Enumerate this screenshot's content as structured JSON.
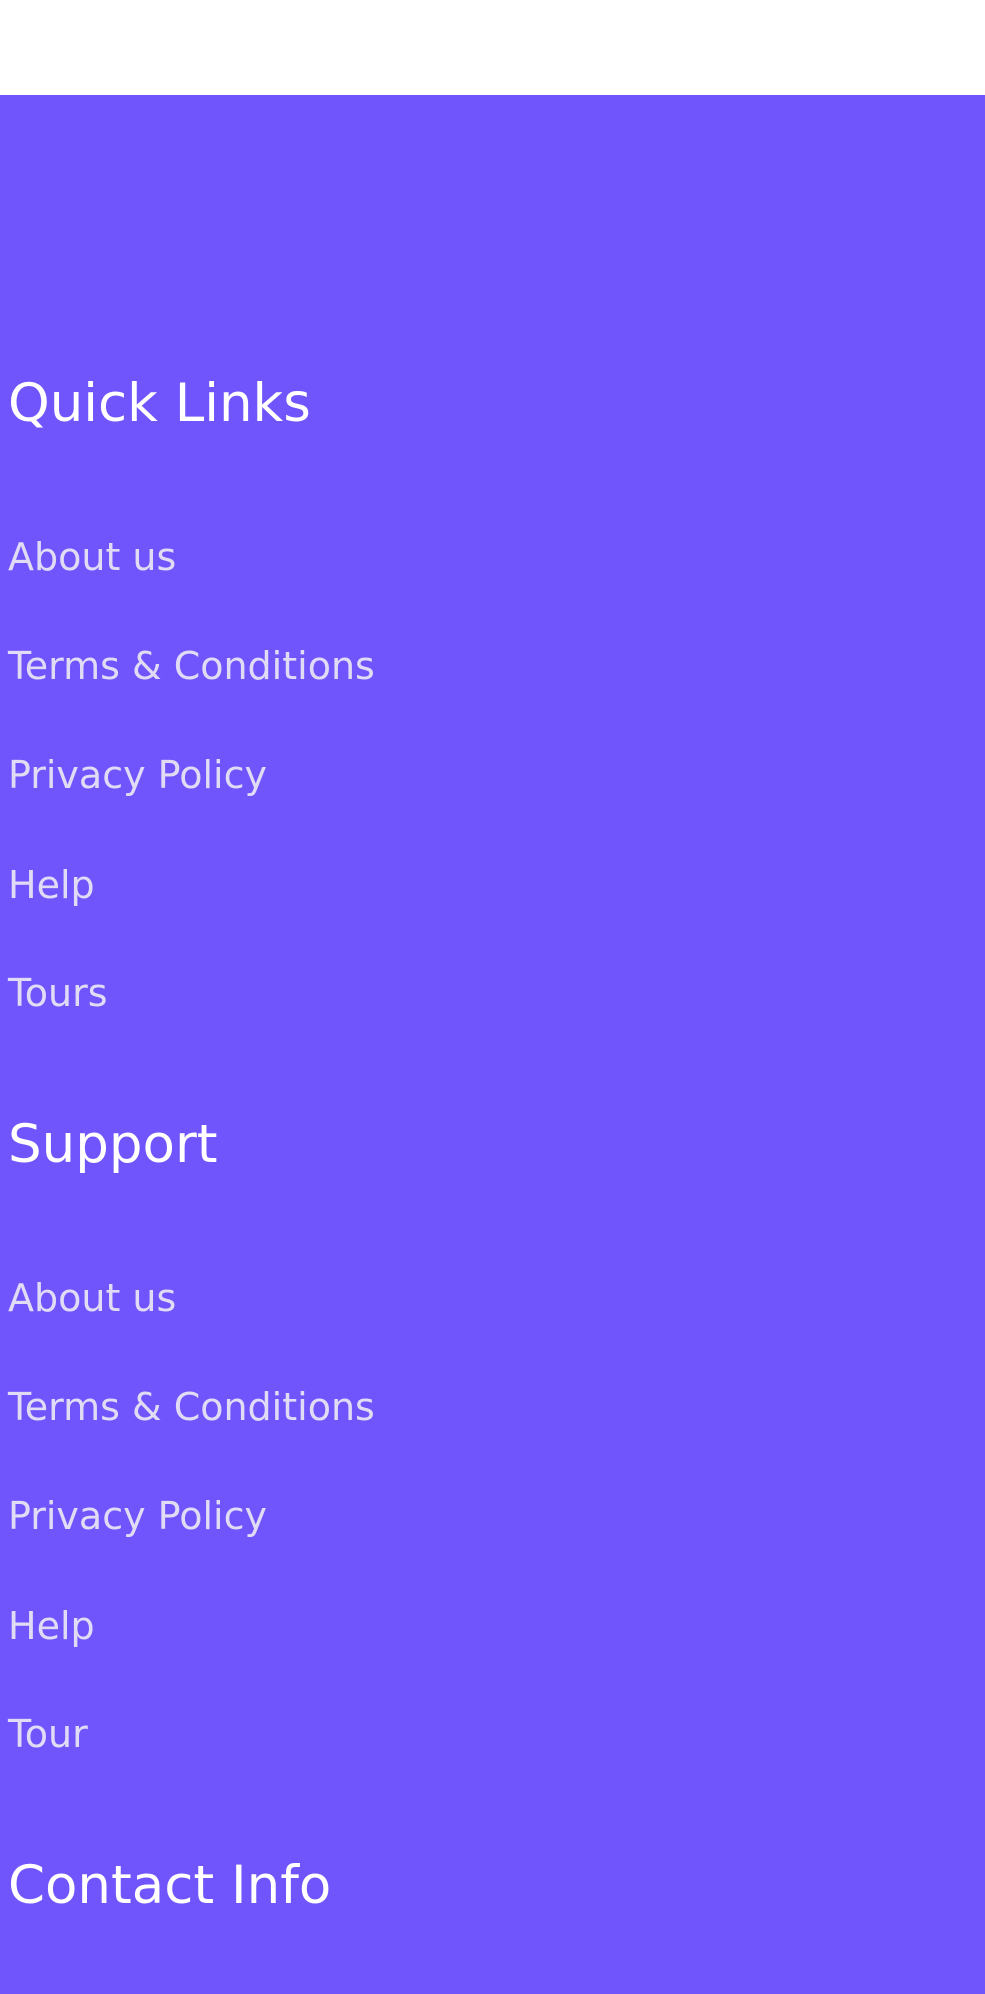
{
  "footer": {
    "background_color": "#7055fc",
    "heading_color": "#ffffff",
    "link_color": "#e2dbf6",
    "quick_links": {
      "heading": "Quick Links",
      "items": [
        "About us",
        "Terms & Conditions",
        "Privacy Policy",
        "Help",
        "Tours"
      ]
    },
    "support": {
      "heading": "Support",
      "items": [
        "About us",
        "Terms & Conditions",
        "Privacy Policy",
        "Help",
        "Tour"
      ]
    },
    "contact_info": {
      "heading": "Contact Info"
    }
  }
}
